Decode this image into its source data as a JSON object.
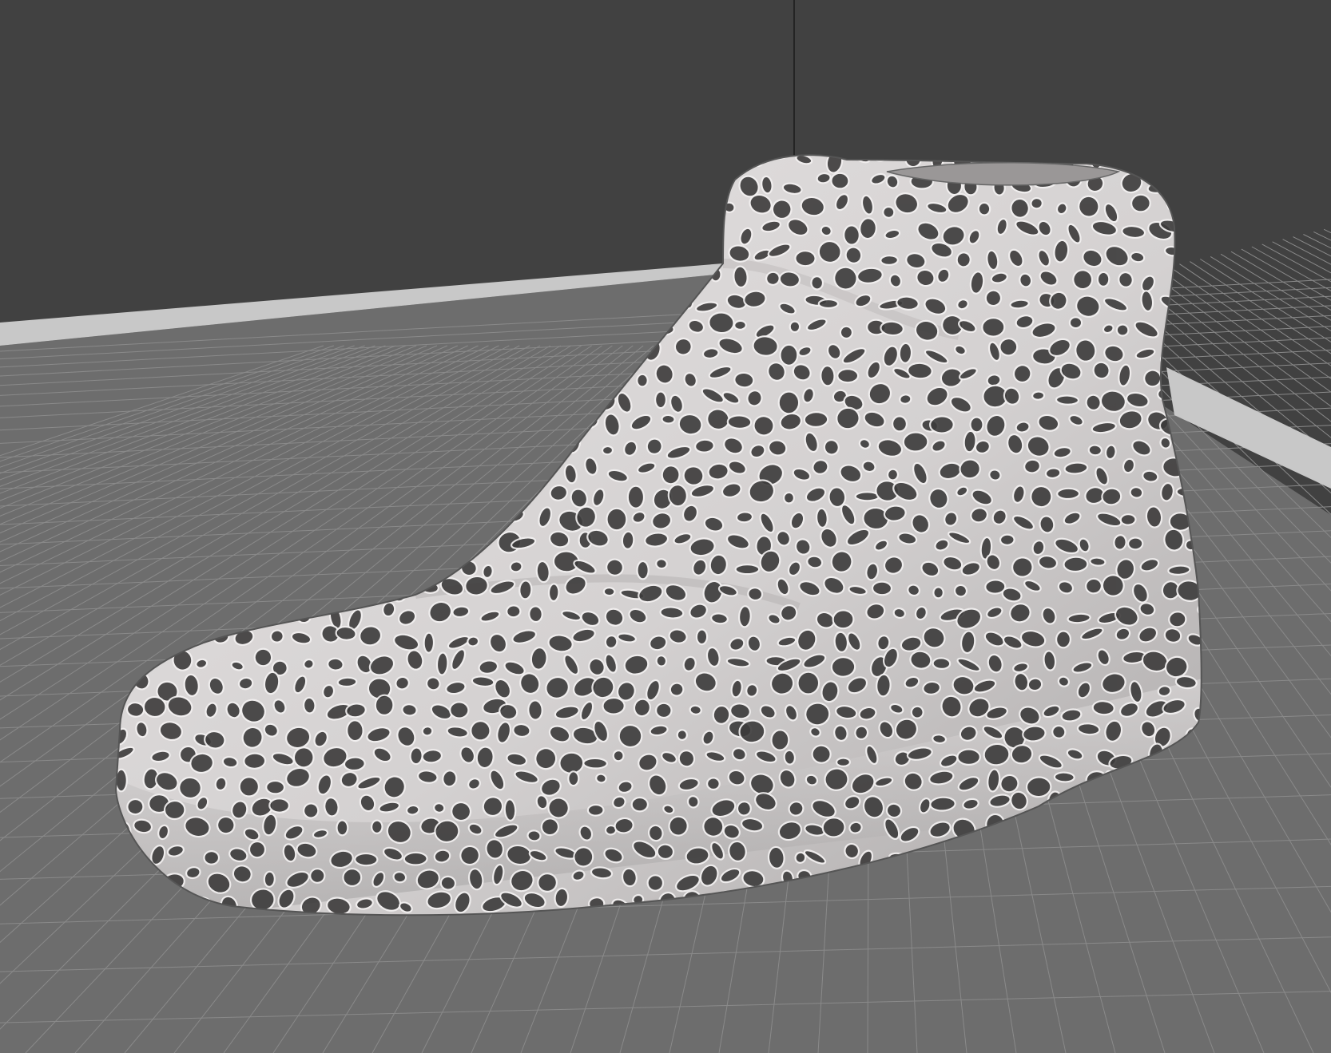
{
  "viewport": {
    "kind": "3d-slicer-viewport",
    "model": "voronoi-lattice-sneaker",
    "colors": {
      "background_wall": "#414141",
      "build_plate": "#6d6d6d",
      "grid_line": "#8a8a8a",
      "plate_border": "#c8c8c8",
      "model_surface": "#d9d6d6",
      "model_holes": "#3c3b3b"
    }
  }
}
